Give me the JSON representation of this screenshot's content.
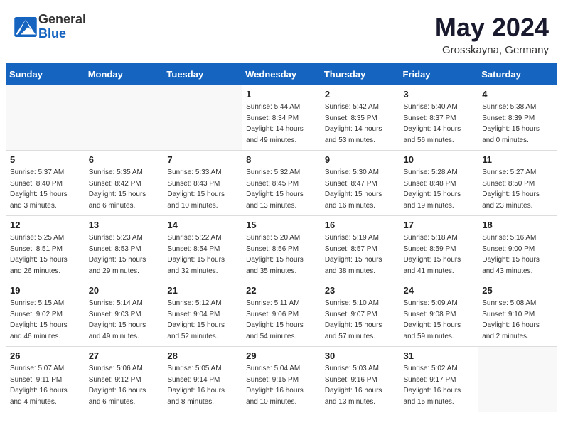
{
  "header": {
    "logo_general": "General",
    "logo_blue": "Blue",
    "month_title": "May 2024",
    "location": "Grosskayna, Germany"
  },
  "days_of_week": [
    "Sunday",
    "Monday",
    "Tuesday",
    "Wednesday",
    "Thursday",
    "Friday",
    "Saturday"
  ],
  "weeks": [
    [
      {
        "day": "",
        "info": ""
      },
      {
        "day": "",
        "info": ""
      },
      {
        "day": "",
        "info": ""
      },
      {
        "day": "1",
        "info": "Sunrise: 5:44 AM\nSunset: 8:34 PM\nDaylight: 14 hours\nand 49 minutes."
      },
      {
        "day": "2",
        "info": "Sunrise: 5:42 AM\nSunset: 8:35 PM\nDaylight: 14 hours\nand 53 minutes."
      },
      {
        "day": "3",
        "info": "Sunrise: 5:40 AM\nSunset: 8:37 PM\nDaylight: 14 hours\nand 56 minutes."
      },
      {
        "day": "4",
        "info": "Sunrise: 5:38 AM\nSunset: 8:39 PM\nDaylight: 15 hours\nand 0 minutes."
      }
    ],
    [
      {
        "day": "5",
        "info": "Sunrise: 5:37 AM\nSunset: 8:40 PM\nDaylight: 15 hours\nand 3 minutes."
      },
      {
        "day": "6",
        "info": "Sunrise: 5:35 AM\nSunset: 8:42 PM\nDaylight: 15 hours\nand 6 minutes."
      },
      {
        "day": "7",
        "info": "Sunrise: 5:33 AM\nSunset: 8:43 PM\nDaylight: 15 hours\nand 10 minutes."
      },
      {
        "day": "8",
        "info": "Sunrise: 5:32 AM\nSunset: 8:45 PM\nDaylight: 15 hours\nand 13 minutes."
      },
      {
        "day": "9",
        "info": "Sunrise: 5:30 AM\nSunset: 8:47 PM\nDaylight: 15 hours\nand 16 minutes."
      },
      {
        "day": "10",
        "info": "Sunrise: 5:28 AM\nSunset: 8:48 PM\nDaylight: 15 hours\nand 19 minutes."
      },
      {
        "day": "11",
        "info": "Sunrise: 5:27 AM\nSunset: 8:50 PM\nDaylight: 15 hours\nand 23 minutes."
      }
    ],
    [
      {
        "day": "12",
        "info": "Sunrise: 5:25 AM\nSunset: 8:51 PM\nDaylight: 15 hours\nand 26 minutes."
      },
      {
        "day": "13",
        "info": "Sunrise: 5:23 AM\nSunset: 8:53 PM\nDaylight: 15 hours\nand 29 minutes."
      },
      {
        "day": "14",
        "info": "Sunrise: 5:22 AM\nSunset: 8:54 PM\nDaylight: 15 hours\nand 32 minutes."
      },
      {
        "day": "15",
        "info": "Sunrise: 5:20 AM\nSunset: 8:56 PM\nDaylight: 15 hours\nand 35 minutes."
      },
      {
        "day": "16",
        "info": "Sunrise: 5:19 AM\nSunset: 8:57 PM\nDaylight: 15 hours\nand 38 minutes."
      },
      {
        "day": "17",
        "info": "Sunrise: 5:18 AM\nSunset: 8:59 PM\nDaylight: 15 hours\nand 41 minutes."
      },
      {
        "day": "18",
        "info": "Sunrise: 5:16 AM\nSunset: 9:00 PM\nDaylight: 15 hours\nand 43 minutes."
      }
    ],
    [
      {
        "day": "19",
        "info": "Sunrise: 5:15 AM\nSunset: 9:02 PM\nDaylight: 15 hours\nand 46 minutes."
      },
      {
        "day": "20",
        "info": "Sunrise: 5:14 AM\nSunset: 9:03 PM\nDaylight: 15 hours\nand 49 minutes."
      },
      {
        "day": "21",
        "info": "Sunrise: 5:12 AM\nSunset: 9:04 PM\nDaylight: 15 hours\nand 52 minutes."
      },
      {
        "day": "22",
        "info": "Sunrise: 5:11 AM\nSunset: 9:06 PM\nDaylight: 15 hours\nand 54 minutes."
      },
      {
        "day": "23",
        "info": "Sunrise: 5:10 AM\nSunset: 9:07 PM\nDaylight: 15 hours\nand 57 minutes."
      },
      {
        "day": "24",
        "info": "Sunrise: 5:09 AM\nSunset: 9:08 PM\nDaylight: 15 hours\nand 59 minutes."
      },
      {
        "day": "25",
        "info": "Sunrise: 5:08 AM\nSunset: 9:10 PM\nDaylight: 16 hours\nand 2 minutes."
      }
    ],
    [
      {
        "day": "26",
        "info": "Sunrise: 5:07 AM\nSunset: 9:11 PM\nDaylight: 16 hours\nand 4 minutes."
      },
      {
        "day": "27",
        "info": "Sunrise: 5:06 AM\nSunset: 9:12 PM\nDaylight: 16 hours\nand 6 minutes."
      },
      {
        "day": "28",
        "info": "Sunrise: 5:05 AM\nSunset: 9:14 PM\nDaylight: 16 hours\nand 8 minutes."
      },
      {
        "day": "29",
        "info": "Sunrise: 5:04 AM\nSunset: 9:15 PM\nDaylight: 16 hours\nand 10 minutes."
      },
      {
        "day": "30",
        "info": "Sunrise: 5:03 AM\nSunset: 9:16 PM\nDaylight: 16 hours\nand 13 minutes."
      },
      {
        "day": "31",
        "info": "Sunrise: 5:02 AM\nSunset: 9:17 PM\nDaylight: 16 hours\nand 15 minutes."
      },
      {
        "day": "",
        "info": ""
      }
    ]
  ]
}
